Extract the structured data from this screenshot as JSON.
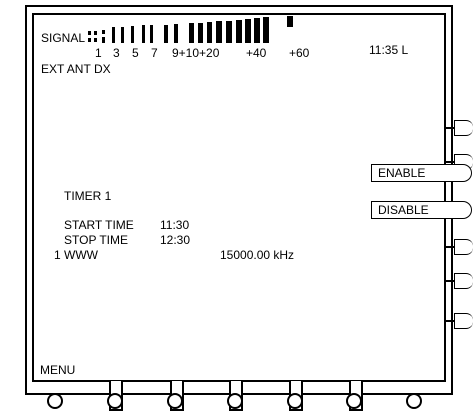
{
  "header": {
    "signal_label": "SIGNAL",
    "scale_labels": [
      "1",
      "3",
      "5",
      "7",
      "9+10+20",
      "+40",
      "+60"
    ],
    "time": "11:35 L",
    "ext_ant": "EXT ANT",
    "mode": "DX"
  },
  "timer": {
    "title": "TIMER 1",
    "start_label": "START TIME",
    "start_value": "11:30",
    "stop_label": "STOP TIME",
    "stop_value": "12:30",
    "station": "1 WWW",
    "frequency": "15000.00 kHz"
  },
  "softkeys": {
    "enable": "ENABLE",
    "disable": "DISABLE"
  },
  "footer": {
    "menu": "MENU"
  }
}
